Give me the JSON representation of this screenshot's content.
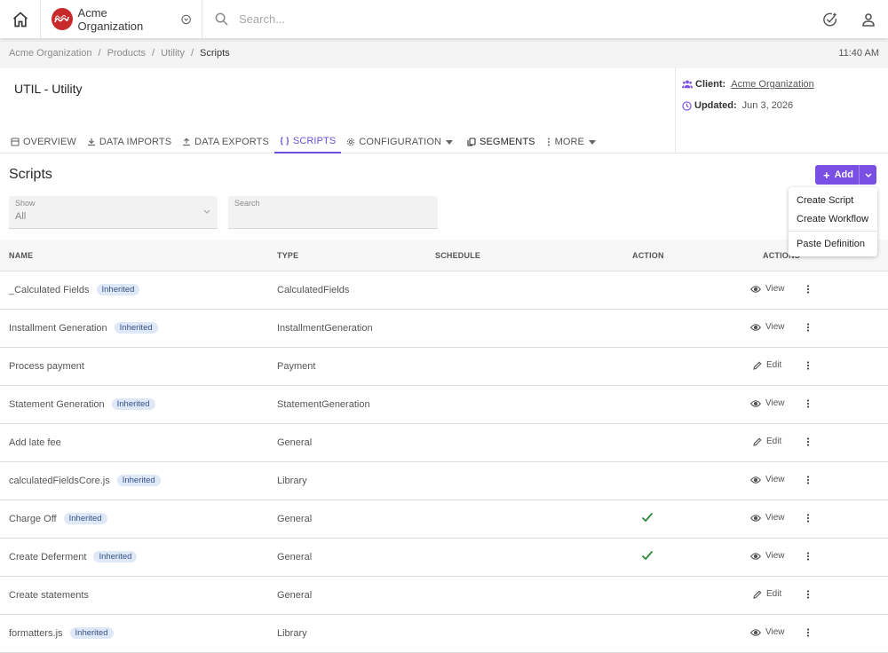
{
  "topbar": {
    "org_name": "Acme Organization",
    "search_placeholder": "Search..."
  },
  "breadcrumb": {
    "items": [
      "Acme Organization",
      "Products",
      "Utility",
      "Scripts"
    ],
    "separator": "/",
    "time": "11:40 AM"
  },
  "header": {
    "title": "UTIL - Utility",
    "client_label": "Client:",
    "client_value": "Acme Organization",
    "updated_label": "Updated:",
    "updated_value": "Jun 3, 2026"
  },
  "tabs": [
    {
      "label": "OVERVIEW",
      "icon": "overview-icon"
    },
    {
      "label": "DATA IMPORTS",
      "icon": "download-icon"
    },
    {
      "label": "DATA EXPORTS",
      "icon": "upload-icon"
    },
    {
      "label": "SCRIPTS",
      "icon": "code-braces-icon",
      "active": true
    },
    {
      "label": "CONFIGURATION",
      "icon": "gear-icon",
      "dropdown": true
    },
    {
      "label": "SEGMENTS",
      "icon": "copy-icon"
    },
    {
      "label": "MORE",
      "icon": "more-vertical-icon",
      "dropdown": true
    }
  ],
  "section": {
    "title": "Scripts",
    "add_label": "Add"
  },
  "add_menu": [
    "Create Script",
    "Create Workflow",
    "Paste Definition"
  ],
  "filters": {
    "show_label": "Show",
    "show_value": "All",
    "search_label": "Search"
  },
  "table": {
    "columns": [
      "NAME",
      "TYPE",
      "SCHEDULE",
      "ACTION",
      "ACTIONS"
    ],
    "rows": [
      {
        "name": "_Calculated Fields",
        "badge": "Inherited",
        "type": "CalculatedFields",
        "action_check": false,
        "btn": "View"
      },
      {
        "name": "Installment Generation",
        "badge": "Inherited",
        "type": "InstallmentGeneration",
        "action_check": false,
        "btn": "View"
      },
      {
        "name": "Process payment",
        "badge": "",
        "type": "Payment",
        "action_check": false,
        "btn": "Edit"
      },
      {
        "name": "Statement Generation",
        "badge": "Inherited",
        "type": "StatementGeneration",
        "action_check": false,
        "btn": "View"
      },
      {
        "name": "Add late fee",
        "badge": "",
        "type": "General",
        "action_check": false,
        "btn": "Edit"
      },
      {
        "name": "calculatedFieldsCore.js",
        "badge": "Inherited",
        "type": "Library",
        "action_check": false,
        "btn": "View"
      },
      {
        "name": "Charge Off",
        "badge": "Inherited",
        "type": "General",
        "action_check": true,
        "btn": "View"
      },
      {
        "name": "Create Deferment",
        "badge": "Inherited",
        "type": "General",
        "action_check": true,
        "btn": "View"
      },
      {
        "name": "Create statements",
        "badge": "",
        "type": "General",
        "action_check": false,
        "btn": "Edit"
      },
      {
        "name": "formatters.js",
        "badge": "Inherited",
        "type": "Library",
        "action_check": false,
        "btn": "View"
      }
    ]
  },
  "colors": {
    "accent": "#7a4fe3",
    "active_tab": "#6b4fd8",
    "badge_bg": "#dfe8f7",
    "check": "#2e8b3a",
    "logo_bg": "#c62a2a"
  }
}
